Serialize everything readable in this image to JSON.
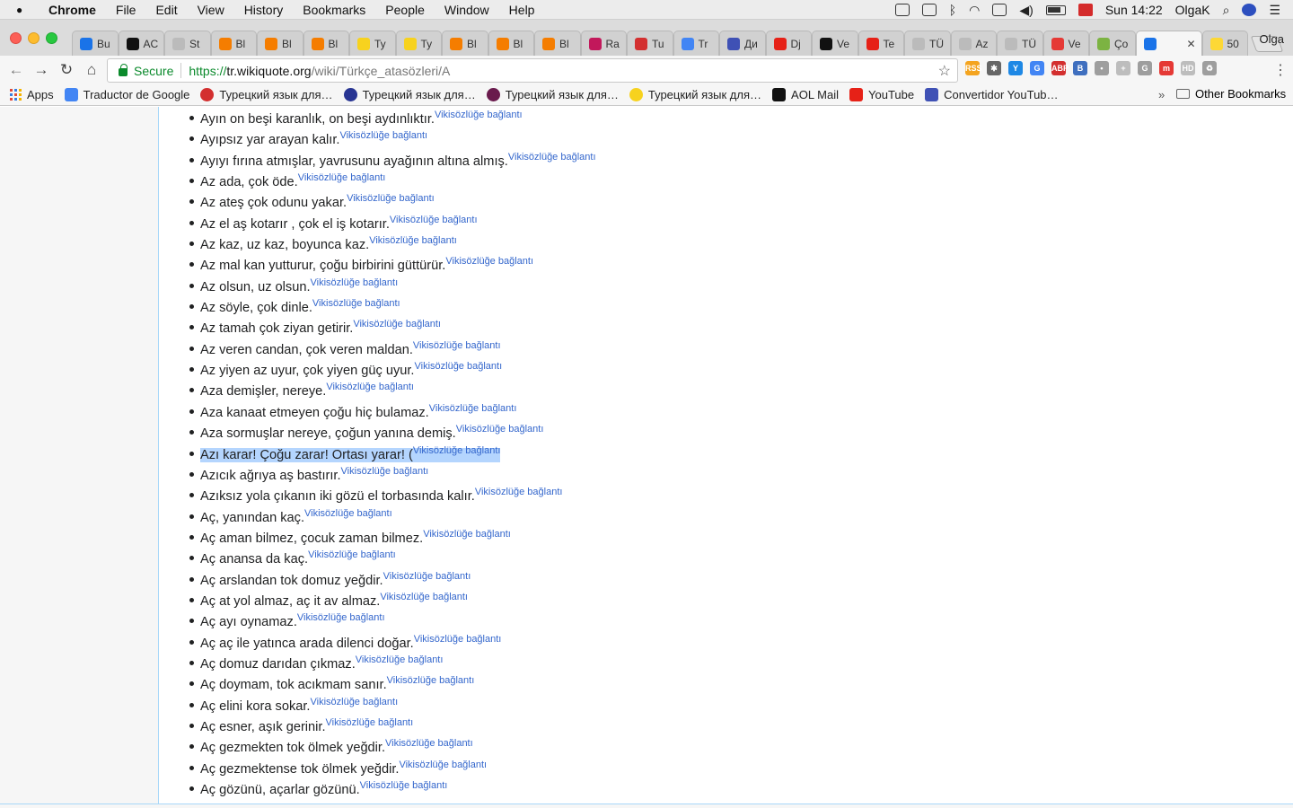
{
  "menubar": {
    "app": "Chrome",
    "menus": [
      "File",
      "Edit",
      "View",
      "History",
      "Bookmarks",
      "People",
      "Window",
      "Help"
    ],
    "clock": "Sun 14:22",
    "user": "OlgaK"
  },
  "tabs": [
    {
      "label": "Bu",
      "color": "#1a73e8"
    },
    {
      "label": "AC",
      "color": "#111111"
    },
    {
      "label": "St",
      "color": "#bbbbbb"
    },
    {
      "label": "Bl",
      "color": "#f57d00"
    },
    {
      "label": "Bl",
      "color": "#f57d00"
    },
    {
      "label": "Bl",
      "color": "#f57d00"
    },
    {
      "label": "Ty",
      "color": "#f7d21e"
    },
    {
      "label": "Ty",
      "color": "#f7d21e"
    },
    {
      "label": "Bl",
      "color": "#f57d00"
    },
    {
      "label": "Bl",
      "color": "#f57d00"
    },
    {
      "label": "Bl",
      "color": "#f57d00"
    },
    {
      "label": "Ra",
      "color": "#c2185b"
    },
    {
      "label": "Tu",
      "color": "#d32f2f"
    },
    {
      "label": "Tr",
      "color": "#4285f4"
    },
    {
      "label": "Ди",
      "color": "#3f51b5"
    },
    {
      "label": "Dj",
      "color": "#e62117"
    },
    {
      "label": "Ve",
      "color": "#111111"
    },
    {
      "label": "Te",
      "color": "#e62117"
    },
    {
      "label": "TÜ",
      "color": "#bbbbbb"
    },
    {
      "label": "Az",
      "color": "#bbbbbb"
    },
    {
      "label": "TÜ",
      "color": "#bbbbbb"
    },
    {
      "label": "Ve",
      "color": "#e53935"
    },
    {
      "label": "Ço",
      "color": "#7cb342"
    },
    {
      "label": "",
      "color": "#1a73e8",
      "active": true
    },
    {
      "label": "50",
      "color": "#fdd835"
    }
  ],
  "profile": "Olga",
  "toolbar": {
    "secure": "Secure",
    "url_scheme": "https://",
    "url_host": "tr.wikiquote.org",
    "url_path": "/wiki/Türkçe_atasözleri/A"
  },
  "extensions": [
    {
      "icon": "rss-icon",
      "color": "#f4a41f",
      "text": "RSS"
    },
    {
      "icon": "spider-icon",
      "color": "#666666",
      "text": "✱"
    },
    {
      "icon": "y-icon",
      "color": "#1e88e5",
      "text": "Y"
    },
    {
      "icon": "translate-icon",
      "color": "#4285f4",
      "text": "G"
    },
    {
      "icon": "abp-icon",
      "color": "#d32f2f",
      "text": "ABP"
    },
    {
      "icon": "b-icon",
      "color": "#3f6fbf",
      "text": "B"
    },
    {
      "icon": "bulb-icon",
      "color": "#9e9e9e",
      "text": "•"
    },
    {
      "icon": "puzzle-icon",
      "color": "#bdbdbd",
      "text": "+"
    },
    {
      "icon": "g-icon",
      "color": "#9e9e9e",
      "text": "G"
    },
    {
      "icon": "m-icon",
      "color": "#e53935",
      "text": "m"
    },
    {
      "icon": "hd-icon",
      "color": "#bdbdbd",
      "text": "HD"
    },
    {
      "icon": "recycle-icon",
      "color": "#9e9e9e",
      "text": "♻"
    }
  ],
  "bookmarks": [
    {
      "label": "Apps",
      "icon": "apps-icon"
    },
    {
      "label": "Traductor de Google",
      "icon": "google-translate-icon",
      "color": "#4285f4"
    },
    {
      "label": "Турецкий язык для…",
      "icon": "red-circle-icon",
      "color": "#d32f2f"
    },
    {
      "label": "Турецкий язык для…",
      "icon": "blue-circle-icon",
      "color": "#283593"
    },
    {
      "label": "Турецкий язык для…",
      "icon": "purple-circle-icon",
      "color": "#6a1b4d"
    },
    {
      "label": "Турецкий язык для…",
      "icon": "yellow-circle-icon",
      "color": "#f7d21e"
    },
    {
      "label": "AOL Mail",
      "icon": "aol-icon",
      "color": "#111111"
    },
    {
      "label": "YouTube",
      "icon": "youtube-icon",
      "color": "#e62117"
    },
    {
      "label": "Convertidor YouTub…",
      "icon": "converter-icon",
      "color": "#3f51b5"
    }
  ],
  "other_bookmarks": "Other Bookmarks",
  "ref_label": "Vikisözlüğe bağlantı",
  "proverbs": [
    "Ayın on beşi karanlık, on beşi aydınlıktır.",
    "Ayıpsız yar arayan kalır.",
    "Ayıyı fırına atmışlar, yavrusunu ayağının altına almış.",
    "Az ada, çok öde.",
    "Az ateş çok odunu yakar.",
    "Az el aş kotarır , çok el iş kotarır.",
    "Az kaz, uz kaz, boyunca kaz.",
    "Az mal kan yutturur, çoğu birbirini güttürür.",
    "Az olsun, uz olsun.",
    "Az söyle, çok dinle.",
    "Az tamah çok ziyan getirir.",
    "Az veren candan, çok veren maldan.",
    "Az yiyen az uyur, çok yiyen güç uyur.",
    "Aza demişler, nereye.",
    "Aza kanaat etmeyen çoğu hiç bulamaz.",
    "Aza sormuşlar nereye, çoğun yanına demiş.",
    "Azı karar! Çoğu zarar! Ortası yarar! (",
    "Azıcık ağrıya aş bastırır.",
    "Azıksız yola çıkanın iki gözü el torbasında kalır.",
    "Aç, yanından kaç.",
    "Aç aman bilmez, çocuk zaman bilmez.",
    "Aç anansa da kaç.",
    "Aç arslandan tok domuz yeğdir.",
    "Aç at yol almaz, aç it av almaz.",
    "Aç ayı oynamaz.",
    "Aç aç ile yatınca arada dilenci doğar.",
    "Aç domuz darıdan çıkmaz.",
    "Aç doymam, tok acıkmam sanır.",
    "Aç elini kora sokar.",
    "Aç esner, aşık gerinir.",
    "Aç gezmekten tok ölmek yeğdir.",
    "Aç gezmektense tok ölmek yeğdir.",
    "Aç gözünü, açarlar gözünü."
  ],
  "selected_index": 16
}
